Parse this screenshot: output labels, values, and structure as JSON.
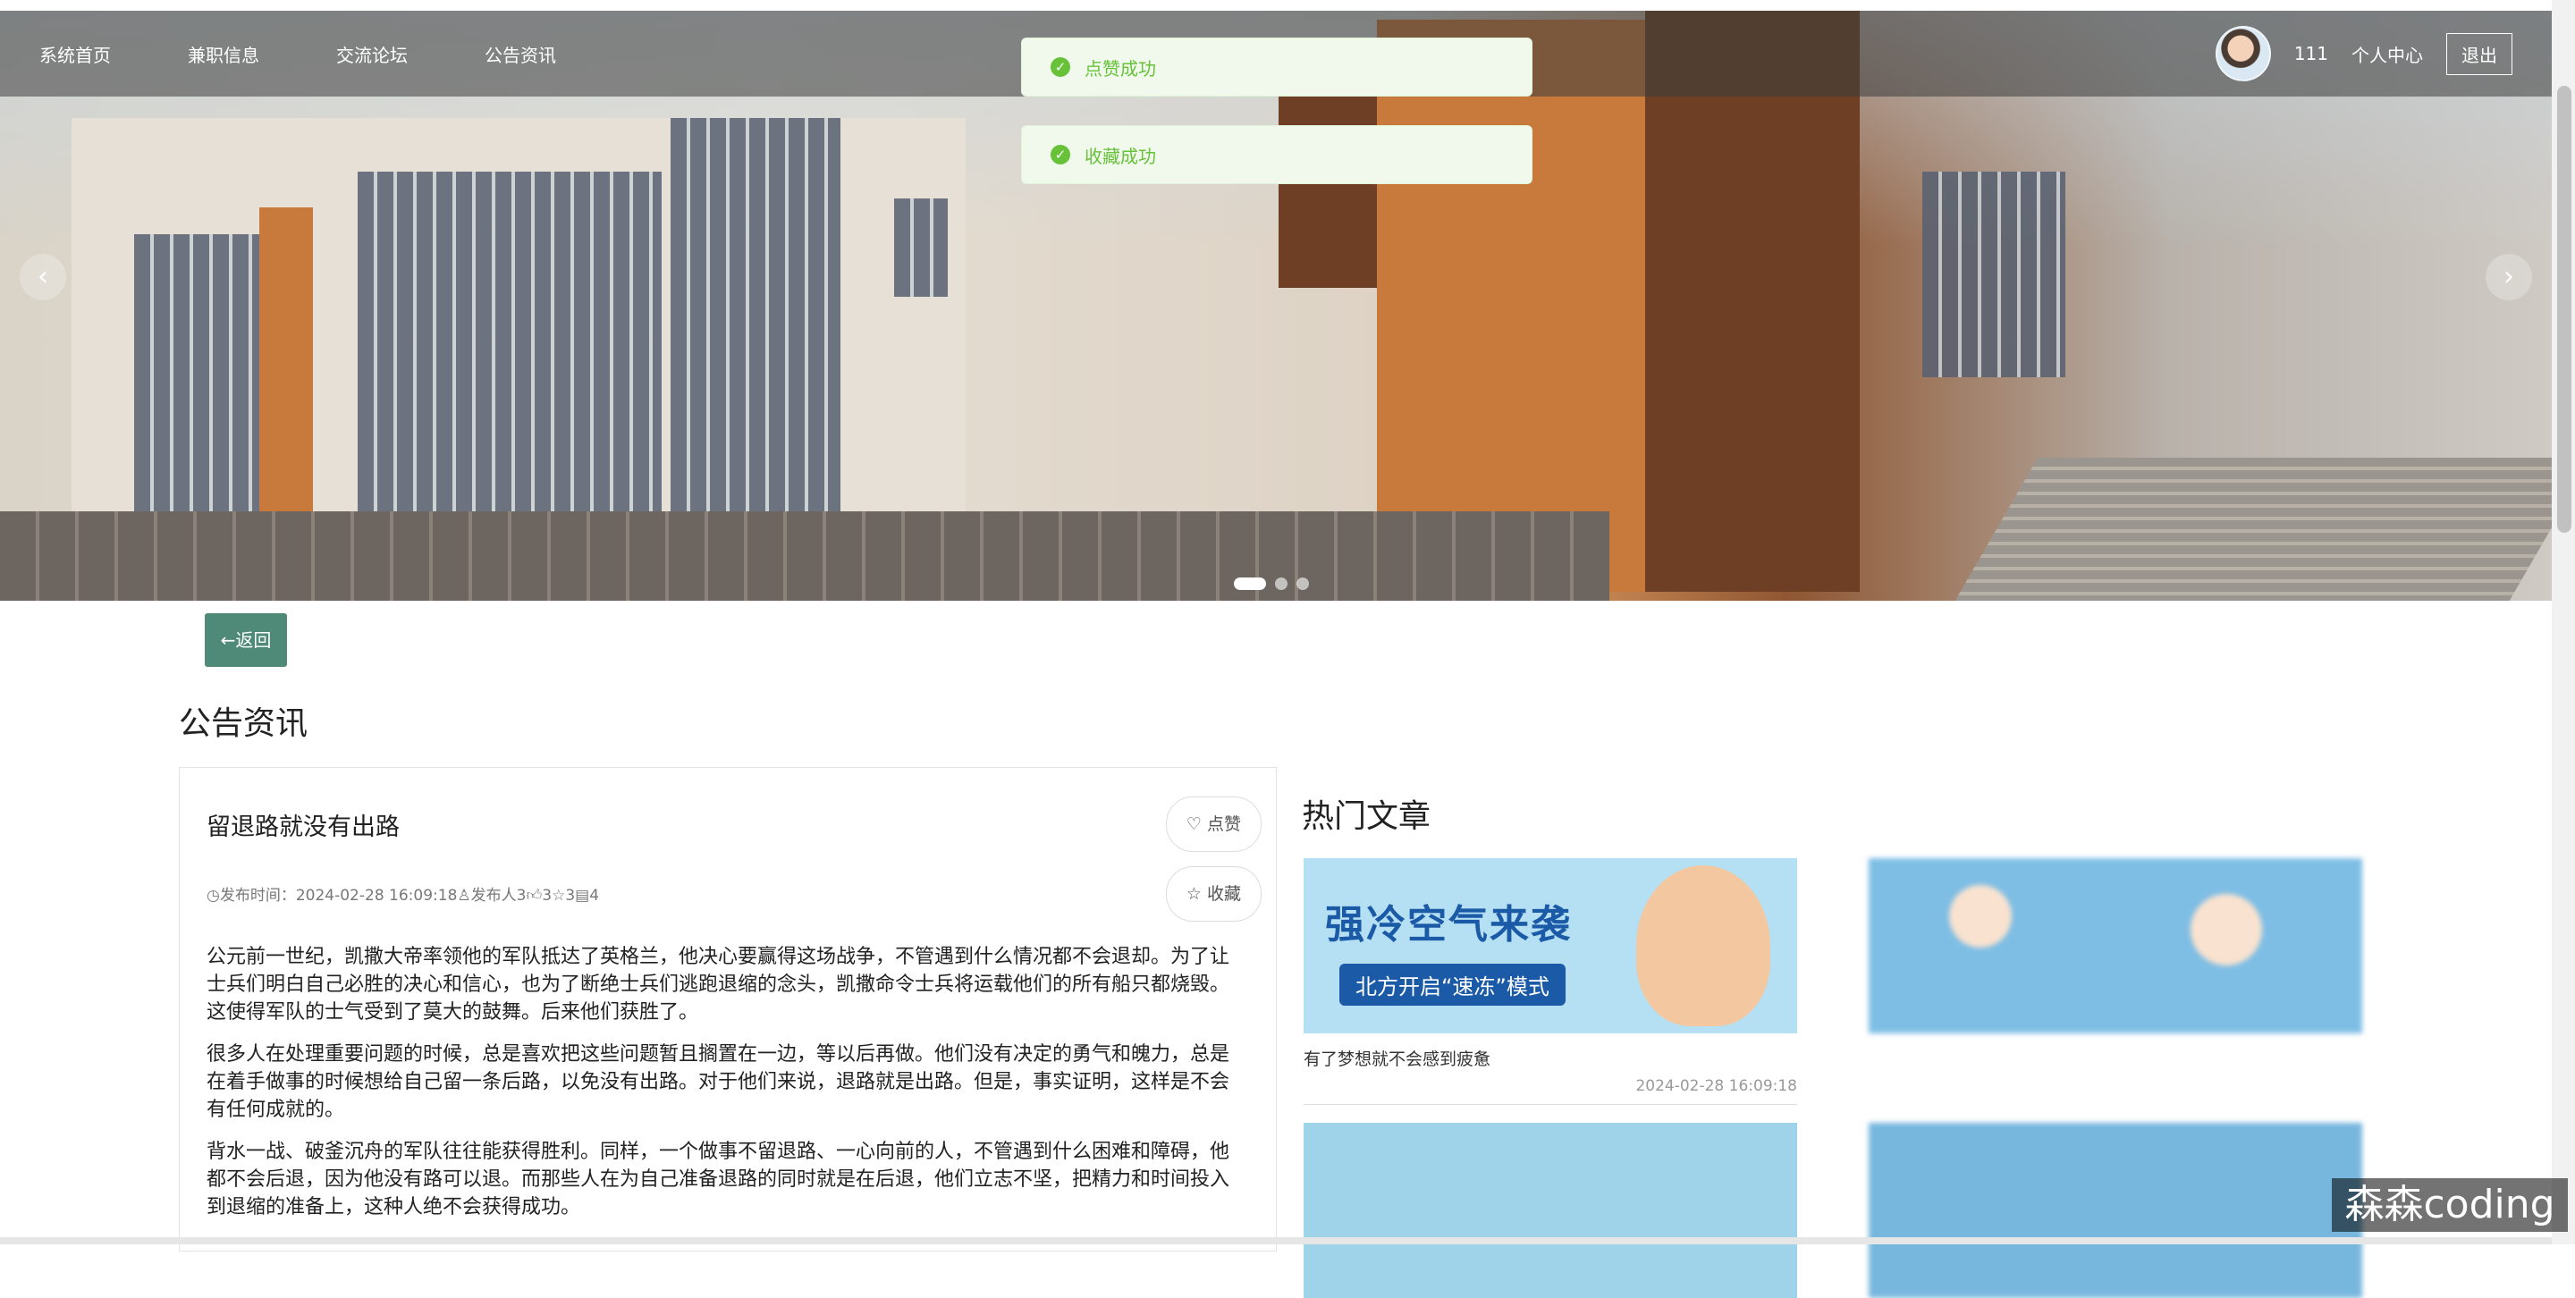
{
  "nav": {
    "items": [
      {
        "label": "系统首页"
      },
      {
        "label": "兼职信息"
      },
      {
        "label": "交流论坛"
      },
      {
        "label": "公告资讯"
      }
    ],
    "username": "111",
    "personal_center": "个人中心",
    "logout": "退出"
  },
  "toasts": [
    {
      "text": "点赞成功",
      "type": "success"
    },
    {
      "text": "收藏成功",
      "type": "success"
    }
  ],
  "carousel": {
    "prev_icon": "‹",
    "next_icon": "›",
    "slide_count": 3,
    "active_slide": 1
  },
  "back_button": "←返回",
  "page_title": "公告资讯",
  "article": {
    "title": "留退路就没有出路",
    "meta": "发布时间：2024-02-28 16:09:18",
    "publisher": "发布人3",
    "likes": "3",
    "favorites": "3",
    "comments": "4",
    "like_button": "点赞",
    "favorite_button": "收藏",
    "paragraphs": [
      "公元前一世纪，凯撒大帝率领他的军队抵达了英格兰，他决心要赢得这场战争，不管遇到什么情况都不会退却。为了让士兵们明白自己必胜的决心和信心，也为了断绝士兵们逃跑退缩的念头，凯撒命令士兵将运载他们的所有船只都烧毁。这使得军队的士气受到了莫大的鼓舞。后来他们获胜了。",
      "很多人在处理重要问题的时候，总是喜欢把这些问题暂且搁置在一边，等以后再做。他们没有决定的勇气和魄力，总是在着手做事的时候想给自己留一条后路，以免没有出路。对于他们来说，退路就是出路。但是，事实证明，这样是不会有任何成就的。",
      "背水一战、破釜沉舟的军队往往能获得胜利。同样，一个做事不留退路、一心向前的人，不管遇到什么困难和障碍，他都不会后退，因为他没有路可以退。而那些人在为自己准备退路的同时就是在后退，他们立志不坚，把精力和时间投入到退缩的准备上，这种人绝不会获得成功。"
    ]
  },
  "hot": {
    "title": "热门文章",
    "items": [
      {
        "caption": "有了梦想就不会感到疲惫",
        "date": "2024-02-28 16:09:18",
        "banner": "强冷空气来袭",
        "banner_sub": "北方开启“速冻”模式"
      }
    ]
  },
  "watermark": "森森coding",
  "colors": {
    "success": "#67c23a",
    "back_button": "#4f8a78"
  }
}
